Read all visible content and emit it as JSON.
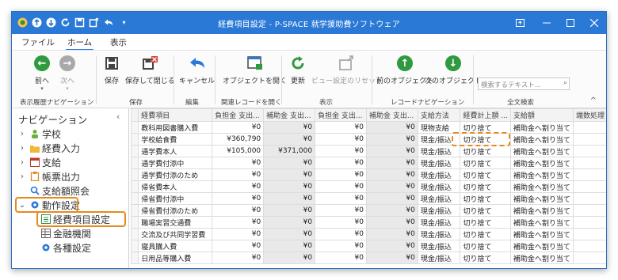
{
  "window": {
    "title": "経費項目設定 - P-SPACE 就学援助費ソフトウェア"
  },
  "menu": [
    {
      "label": "ファイル"
    },
    {
      "label": "ホーム"
    },
    {
      "label": "表示"
    }
  ],
  "ribbon": {
    "buttons": {
      "back": "前へ",
      "forward": "次へ",
      "save": "保存",
      "save_close": "保存して閉じる",
      "cancel": "キャンセル",
      "open_object": "オブジェクトを開く",
      "refresh": "更新",
      "reset_view": "ビュー設定のリセット",
      "prev_object": "前のオブジェクト",
      "next_object": "次のオブジェクト"
    },
    "groups": {
      "history": "表示履歴ナビゲーション",
      "save": "保存",
      "edit": "編集",
      "related": "関連レコードを開く",
      "view": "表示",
      "record_nav": "レコードナビゲーション",
      "search": "全文検索"
    },
    "search_placeholder": "検索するテキスト..."
  },
  "sidebar": {
    "title": "ナビゲーション",
    "items": [
      {
        "label": "学校"
      },
      {
        "label": "経費入力"
      },
      {
        "label": "支給"
      },
      {
        "label": "帳票出力"
      },
      {
        "label": "支給額照会"
      },
      {
        "label": "動作設定"
      },
      {
        "label": "経費項目設定"
      },
      {
        "label": "金融機関"
      },
      {
        "label": "各種設定"
      }
    ]
  },
  "grid": {
    "columns": [
      "経費項目",
      "負担金 支出...",
      "補助金 支出...",
      "負担金 支出...",
      "補助金 支出...",
      "支給方法",
      "経費計上額 ...",
      "支給額",
      "端数処理"
    ],
    "rows": [
      [
        "教科用図書購入費",
        "¥0",
        "¥0",
        "¥0",
        "¥0",
        "現物支給",
        "切り捨て",
        "補助金へ割り当て",
        ""
      ],
      [
        "学校給食費",
        "¥360,790",
        "¥0",
        "¥0",
        "¥0",
        "現金/振込",
        "切り捨て",
        "補助金へ割り当て",
        ""
      ],
      [
        "通学費本人",
        "¥105,000",
        "¥371,000",
        "¥0",
        "¥0",
        "現金/振込",
        "切り捨て",
        "補助金へ割り当て",
        ""
      ],
      [
        "通学費付添中",
        "¥0",
        "¥0",
        "¥0",
        "¥0",
        "現金/振込",
        "切り捨て",
        "補助金へ割り当て",
        ""
      ],
      [
        "通学費付添のため",
        "¥0",
        "¥0",
        "¥0",
        "¥0",
        "現金/振込",
        "切り捨て",
        "補助金へ割り当て",
        ""
      ],
      [
        "帰省費本人",
        "¥0",
        "¥0",
        "¥0",
        "¥0",
        "現金/振込",
        "切り捨て",
        "補助金へ割り当て",
        ""
      ],
      [
        "帰省費付添中",
        "¥0",
        "¥0",
        "¥0",
        "¥0",
        "現金/振込",
        "切り捨て",
        "補助金へ割り当て",
        ""
      ],
      [
        "帰省費付添のため",
        "¥0",
        "¥0",
        "¥0",
        "¥0",
        "現金/振込",
        "切り捨て",
        "補助金へ割り当て",
        ""
      ],
      [
        "職場実習交通費",
        "¥0",
        "¥0",
        "¥0",
        "¥0",
        "現金/振込",
        "切り捨て",
        "補助金へ割り当て",
        ""
      ],
      [
        "交流及び共同学習費",
        "¥0",
        "¥0",
        "¥0",
        "¥0",
        "現金/振込",
        "切り捨て",
        "補助金へ割り当て",
        ""
      ],
      [
        "寝具購入費",
        "¥0",
        "¥0",
        "¥0",
        "¥0",
        "現金/振込",
        "切り捨て",
        "補助金へ割り当て",
        ""
      ],
      [
        "日用品等購入費",
        "¥0",
        "¥0",
        "¥0",
        "¥0",
        "現金/振込",
        "切り捨て",
        "補助金へ割り当て",
        ""
      ]
    ]
  },
  "colors": {
    "accent": "#2b79d6",
    "highlight": "#e58a1f",
    "go_green": "#2f9a3f"
  }
}
